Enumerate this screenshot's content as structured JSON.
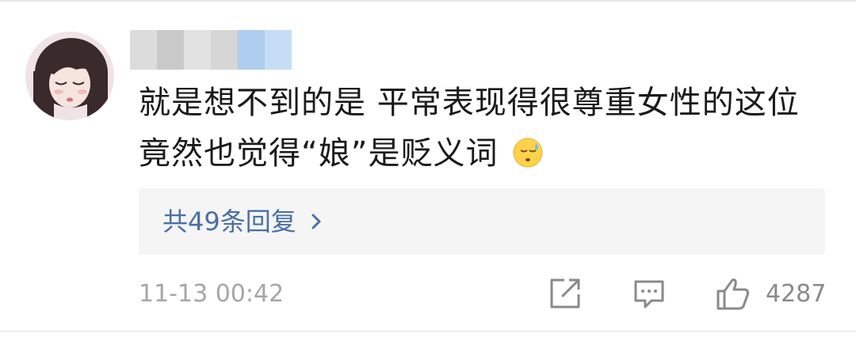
{
  "comment": {
    "text_line1": "就是想不到的是 平常表现得很尊重女性的这位",
    "text_line2": "竟然也觉得“娘”是贬义词",
    "emoji": "cold-sweat-face-icon"
  },
  "replies": {
    "link_label": "共49条回复"
  },
  "footer": {
    "timestamp": "11-13 00:42",
    "like_count": "4287"
  },
  "icons": {
    "share": "share-icon",
    "comment": "comment-icon",
    "like": "thumbs-up-icon",
    "chevron": "chevron-right-icon"
  },
  "colors": {
    "text": "#1a1a1a",
    "link": "#4a6fa3",
    "meta": "#a6a6a6",
    "reply_bg": "#f5f5f6"
  }
}
